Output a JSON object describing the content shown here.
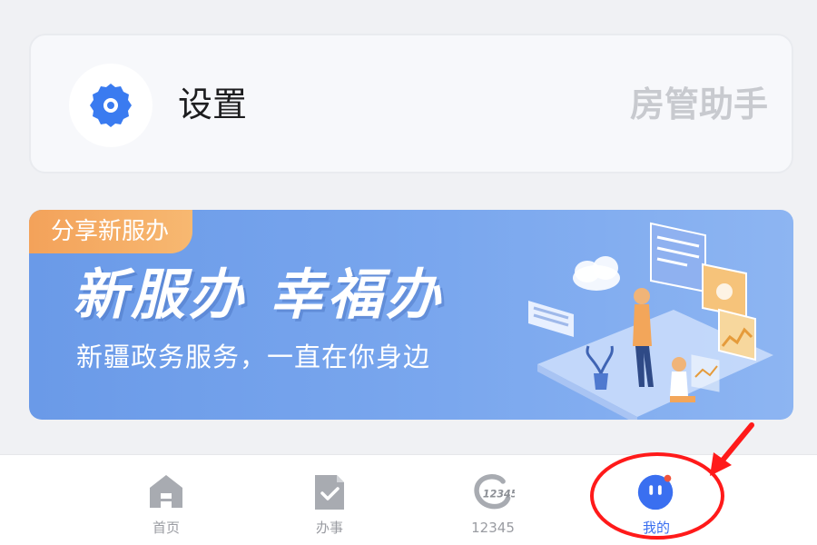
{
  "settings": {
    "label": "设置",
    "right_text": "房管助手",
    "icon": "gear-icon"
  },
  "banner": {
    "tag": "分享新服办",
    "title": "新服办  幸福办",
    "subtitle": "新疆政务服务，一直在你身边"
  },
  "nav": {
    "items": [
      {
        "label": "首页",
        "icon": "home-icon",
        "active": false
      },
      {
        "label": "办事",
        "icon": "document-check-icon",
        "active": false
      },
      {
        "label": "12345",
        "icon": "hotline-12345-icon",
        "badge": "12345",
        "active": false
      },
      {
        "label": "我的",
        "icon": "profile-face-icon",
        "active": true
      }
    ]
  },
  "colors": {
    "accent": "#3a6ff0",
    "annotation": "#ff1a1a",
    "banner_tag": "#f3a25a"
  }
}
